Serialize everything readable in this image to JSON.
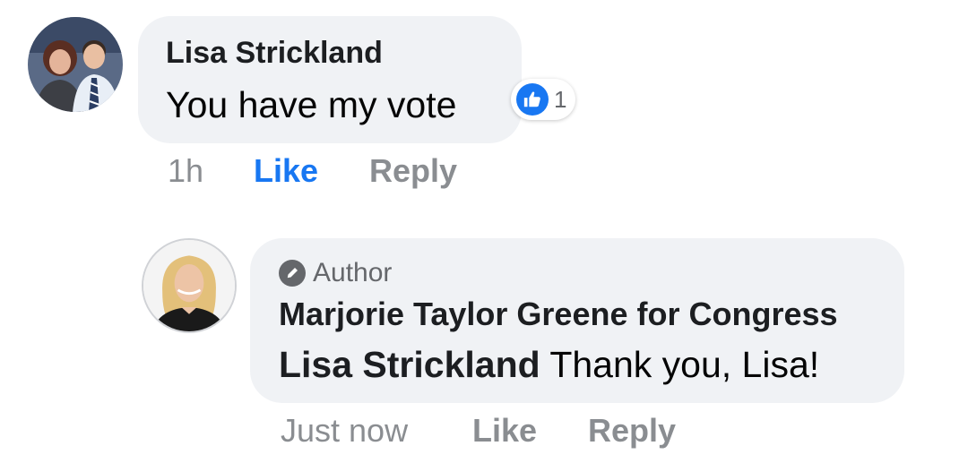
{
  "comments": [
    {
      "author": "Lisa Strickland",
      "text": "You have my vote",
      "time": "1h",
      "like_label": "Like",
      "reply_label": "Reply",
      "reaction": {
        "icon": "thumbs-up-icon",
        "count": "1",
        "color": "#1877f2"
      },
      "liked": true
    },
    {
      "badge": "Author",
      "badge_icon": "pencil-icon",
      "author": "Marjorie Taylor Greene for Congress",
      "mention": "Lisa Strickland",
      "text": "Thank you, Lisa!",
      "time": "Just now",
      "like_label": "Like",
      "reply_label": "Reply",
      "liked": false
    }
  ],
  "colors": {
    "bubble": "#f0f2f5",
    "link_blue": "#1877f2",
    "meta_grey": "#8a8d91"
  }
}
